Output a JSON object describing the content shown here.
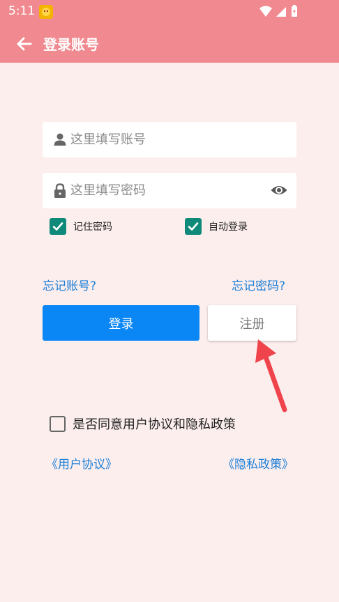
{
  "status": {
    "time": "5:11"
  },
  "appbar": {
    "title": "登录账号"
  },
  "login": {
    "account_placeholder": "这里填写账号",
    "account_value": "",
    "password_placeholder": "这里填写密码",
    "password_value": "",
    "remember_label": "记住密码",
    "remember_checked": true,
    "autologin_label": "自动登录",
    "autologin_checked": true,
    "forgot_account": "忘记账号?",
    "forgot_password": "忘记密码?",
    "login_button": "登录",
    "register_button": "注册"
  },
  "agreement": {
    "label": "是否同意用户协议和隐私政策",
    "checked": false,
    "user_agreement_link": "《用户协议》",
    "privacy_policy_link": "《隐私政策》"
  },
  "colors": {
    "header": "#f08a90",
    "background": "#fdeeee",
    "primary": "#0a86f5",
    "checkbox": "#0f8a7a",
    "link": "#1b7fd6",
    "annotation": "#f0444c"
  },
  "icons": [
    "back-arrow-icon",
    "user-icon",
    "lock-icon",
    "eye-icon",
    "checkmark-icon",
    "wifi-icon",
    "signal-icon",
    "battery-icon"
  ]
}
